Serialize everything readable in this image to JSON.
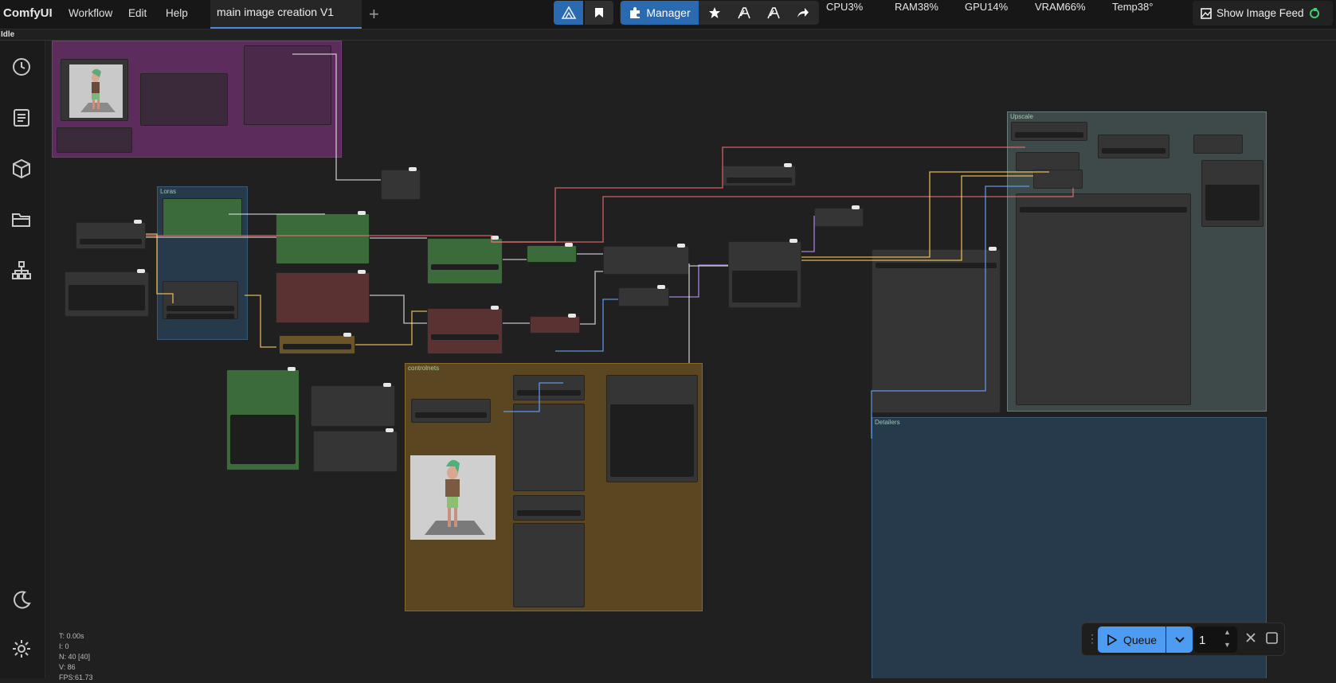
{
  "app": {
    "name": "ComfyUI",
    "status": "Idle"
  },
  "menu": [
    "Workflow",
    "Edit",
    "Help"
  ],
  "tabs": [
    {
      "label": "main image creation V1"
    }
  ],
  "toolbar": {
    "manager_label": "Manager",
    "feed_label": "Show Image Feed"
  },
  "stats": {
    "cpu": "CPU3%",
    "ram": "RAM38%",
    "gpu": "GPU14%",
    "vram": "VRAM66%",
    "temp": "Temp38°"
  },
  "canvas_info": {
    "t": "T: 0.00s",
    "i": "I: 0",
    "n": "N: 40 [40]",
    "v": "V: 86",
    "fps": "FPS:61.73"
  },
  "groups": {
    "loras": "Loras",
    "controlnets": "controlnets",
    "upscale": "Upscale",
    "detailers": "Detailers"
  },
  "queue": {
    "button_label": "Queue",
    "count": "1"
  },
  "colors": {
    "accent": "#2a6ab0",
    "queue": "#4e9bf2",
    "green_node": "#3b6b3b",
    "red_node": "#5a3232"
  }
}
